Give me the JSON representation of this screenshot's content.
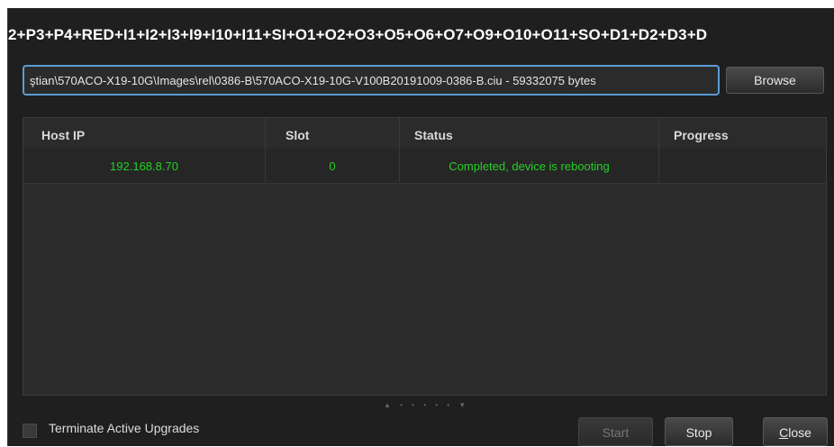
{
  "title": "2+P3+P4+RED+I1+I2+I3+I9+I10+I11+SI+O1+O2+O3+O5+O6+O7+O9+O10+O11+SO+D1+D2+D3+D",
  "file_path": "ştian\\570ACO-X19-10G\\Images\\rel\\0386-B\\570ACO-X19-10G-V100B20191009-0386-B.ciu  -  59332075 bytes",
  "browse_label": "Browse",
  "table": {
    "headers": [
      "Host IP",
      "Slot",
      "Status",
      "Progress"
    ],
    "rows": [
      [
        "192.168.8.70",
        "0",
        "Completed, device is rebooting",
        ""
      ]
    ],
    "text_color": "#25d025"
  },
  "resize_handle": "▲ • • • • • ▼",
  "terminate_label": "Terminate Active Upgrades",
  "terminate_checked": false,
  "buttons": {
    "start": "Start",
    "stop": "Stop",
    "close_prefix": "C",
    "close_rest": "lose"
  },
  "colors": {
    "accent": "#5b9bd5",
    "background": "#1f1f1f"
  }
}
